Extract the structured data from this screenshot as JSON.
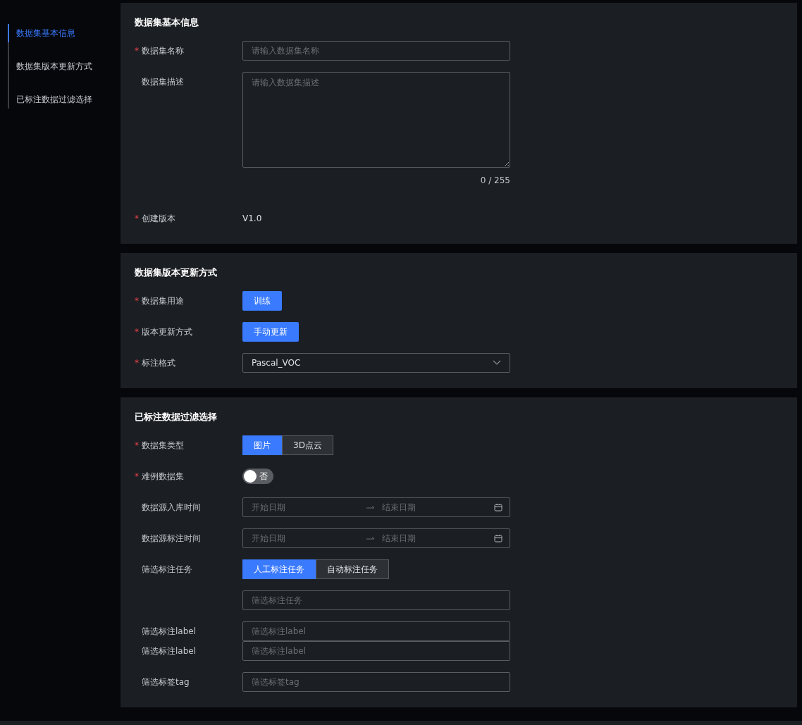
{
  "sidebar": {
    "items": [
      {
        "label": "数据集基本信息",
        "selected": true
      },
      {
        "label": "数据集版本更新方式",
        "selected": false
      },
      {
        "label": "已标注数据过滤选择",
        "selected": false
      }
    ]
  },
  "sections": [
    {
      "title": "数据集基本信息",
      "fields": [
        {
          "kind": "input",
          "label": "数据集名称",
          "required_mark": "*",
          "placeholder": "请输入数据集名称"
        },
        {
          "kind": "textarea",
          "label": "数据集描述",
          "placeholder": "请输入数据集描述",
          "counter": "0 / 255"
        },
        {
          "kind": "text",
          "label": "创建版本",
          "required_mark": "*",
          "value": "V1.0"
        }
      ]
    },
    {
      "title": "数据集版本更新方式",
      "fields": [
        {
          "kind": "button",
          "label": "数据集用途",
          "required_mark": "*",
          "value": "训练"
        },
        {
          "kind": "button",
          "label": "版本更新方式",
          "required_mark": "*",
          "value": "手动更新"
        },
        {
          "kind": "select",
          "label": "标注格式",
          "required_mark": "*",
          "value": "Pascal_VOC"
        }
      ]
    },
    {
      "title": "已标注数据过滤选择",
      "fields": [
        {
          "kind": "segmented",
          "label": "数据集类型",
          "required_mark": "*",
          "options": [
            {
              "label": "图片",
              "selected": true
            },
            {
              "label": "3D点云",
              "selected": false
            }
          ]
        },
        {
          "kind": "switch",
          "label": "难例数据集",
          "required_mark": "*",
          "on": false,
          "value": "否"
        },
        {
          "kind": "daterange",
          "label": "数据源入库时间",
          "start_placeholder": "开始日期",
          "end_placeholder": "结束日期"
        },
        {
          "kind": "daterange",
          "label": "数据源标注时间",
          "start_placeholder": "开始日期",
          "end_placeholder": "结束日期"
        },
        {
          "kind": "segmented",
          "label": "筛选标注任务",
          "options": [
            {
              "label": "人工标注任务",
              "selected": true
            },
            {
              "label": "自动标注任务",
              "selected": false
            }
          ]
        },
        {
          "kind": "input",
          "placeholder": "筛选标注任务"
        },
        {
          "kind": "input",
          "label": "筛选标注label",
          "placeholder": "筛选标注label"
        },
        {
          "kind": "input",
          "label": "筛选标注label",
          "placeholder": "筛选标注label",
          "compact": true
        },
        {
          "kind": "input",
          "label": "筛选标签tag",
          "placeholder": "筛选标签tag"
        }
      ]
    }
  ]
}
